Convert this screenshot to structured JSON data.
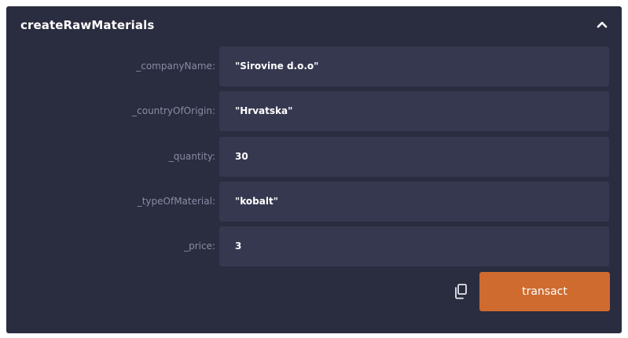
{
  "function": {
    "title": "createRawMaterials",
    "collapse_icon": "chevron-up-icon"
  },
  "params": [
    {
      "label": "_companyName:",
      "value": "\"Sirovine d.o.o\""
    },
    {
      "label": "_countryOfOrigin:",
      "value": "\"Hrvatska\""
    },
    {
      "label": "_quantity:",
      "value": "30"
    },
    {
      "label": "_typeOfMaterial:",
      "value": "\"kobalt\""
    },
    {
      "label": "_price:",
      "value": "3"
    }
  ],
  "actions": {
    "copy_icon": "copy-icon",
    "transact_label": "transact"
  },
  "colors": {
    "panel_bg": "#2a2c3f",
    "field_bg": "#35384f",
    "label_text": "#8a8ca6",
    "value_text": "#ffffff",
    "accent": "#cf6b2e"
  }
}
